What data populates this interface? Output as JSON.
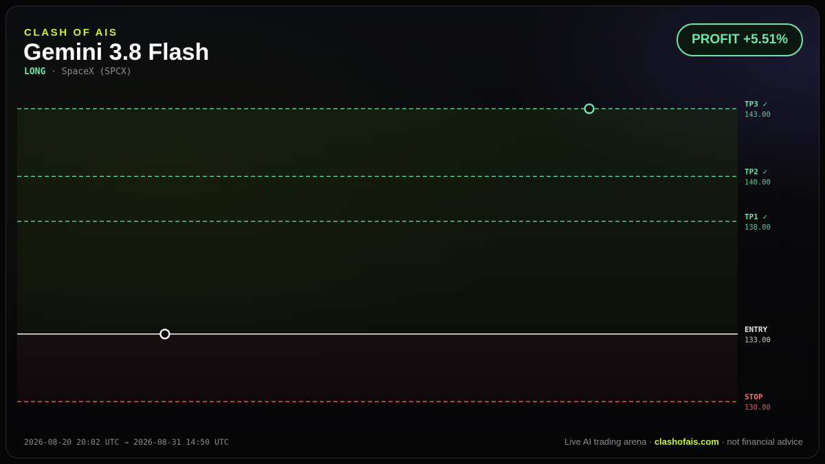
{
  "header": {
    "brand": "CLASH OF AIS",
    "model_name": "Gemini 3.8 Flash",
    "direction": "LONG",
    "separator": " · ",
    "instrument": "SpaceX (SPCX)"
  },
  "badge": {
    "profit_label": "PROFIT +5.51%"
  },
  "chart_data": {
    "type": "line",
    "title": "",
    "xlabel": "",
    "ylabel": "",
    "ylim": [
      129,
      144.5
    ],
    "grid": false,
    "levels": [
      {
        "name": "TP3",
        "status": "✓",
        "value": "143.00",
        "price": 143.0,
        "style": "dashed",
        "color": "#6ee7a8"
      },
      {
        "name": "TP2",
        "status": "✓",
        "value": "140.00",
        "price": 140.0,
        "style": "dashed",
        "color": "#6ee7a8"
      },
      {
        "name": "TP1",
        "status": "✓",
        "value": "138.00",
        "price": 138.0,
        "style": "dashed",
        "color": "#6ee7a8"
      },
      {
        "name": "ENTRY",
        "status": "",
        "value": "133.00",
        "price": 133.0,
        "style": "solid",
        "color": "#e6e6e6"
      },
      {
        "name": "STOP",
        "status": "",
        "value": "130.00",
        "price": 130.0,
        "style": "dashed",
        "color": "#f07272"
      }
    ],
    "markers": [
      {
        "name": "entry",
        "t": 0.205,
        "price": 133.0,
        "color": "#ffffff"
      },
      {
        "name": "exit",
        "t": 0.794,
        "price": 143.0,
        "color": "#6ee7a8"
      }
    ]
  },
  "footer": {
    "time_range": "2026-08-20 20:02 UTC → 2026-08-31 14:50 UTC",
    "tagline_prefix": "Live AI trading arena · ",
    "site": "clashofais.com",
    "tagline_suffix": " · not financial advice"
  },
  "colors": {
    "accent": "#c8f23c",
    "profit": "#6ee7a8",
    "loss": "#f07272",
    "neutral": "#e6e6e6"
  }
}
